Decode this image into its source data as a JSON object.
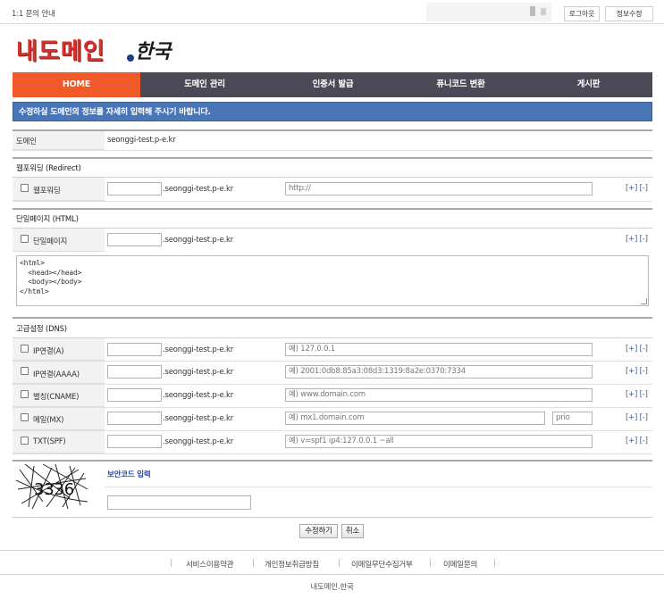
{
  "topbar": {
    "inquiry": "1:1 문의 안내",
    "logout": "로그아웃",
    "profile": "정보수정"
  },
  "logo": {
    "main": "내도메인",
    "sub": "한국"
  },
  "nav": {
    "items": [
      "HOME",
      "도메인 관리",
      "인증서 발급",
      "퓨니코드 변환",
      "게시판"
    ],
    "active_index": 0
  },
  "notice": "수정하실 도메인의 정보를 자세히 입력해 주시기 바랍니다.",
  "domain": {
    "label": "도메인",
    "value": "seonggi-test.p-e.kr"
  },
  "suffix": ".seonggi-test.p-e.kr",
  "plus_minus": "[+] [-]",
  "redirect": {
    "title": "웹포워딩 (Redirect)",
    "check_label": "웹포워딩",
    "url_placeholder": "http://"
  },
  "single": {
    "title": "단일페이지 (HTML)",
    "check_label": "단일페이지",
    "html": "<html>\n  <head></head>\n  <body></body>\n</html>"
  },
  "dns": {
    "title": "고급설정 (DNS)",
    "rows": [
      {
        "label": "IP연결(A)",
        "placeholder": "예) 127.0.0.1"
      },
      {
        "label": "IP연결(AAAA)",
        "placeholder": "예) 2001:0db8:85a3:08d3:1319:8a2e:0370:7334"
      },
      {
        "label": "별칭(CNAME)",
        "placeholder": "예) www.domain.com"
      },
      {
        "label": "메일(MX)",
        "placeholder": "예) mx1.domain.com",
        "prio_placeholder": "prio"
      },
      {
        "label": "TXT(SPF)",
        "placeholder": "예) v=spf1 ip4:127.0.0.1 ~all"
      }
    ]
  },
  "captcha": {
    "code": "3336",
    "title": "보안코드 입력"
  },
  "buttons": {
    "submit": "수정하기",
    "cancel": "취소"
  },
  "footer": {
    "links": [
      "서비스이용약관",
      "개인정보취급방침",
      "이메일무단수집거부",
      "이메일문의"
    ],
    "copyright": "내도메인.한국"
  },
  "colors": {
    "nav_bg": "#4a4a57",
    "nav_active": "#f05a28",
    "notice_bg": "#4a76b8",
    "logo_red": "#d6322b",
    "link_blue": "#3c5a8c"
  }
}
